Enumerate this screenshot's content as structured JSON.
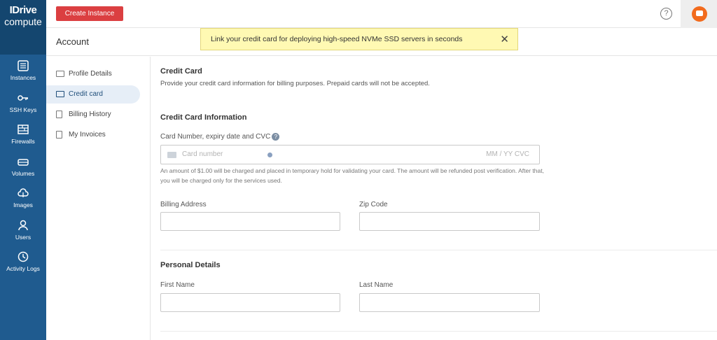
{
  "brand": {
    "line1": "IDrive",
    "line2": "compute"
  },
  "sidebar": {
    "items": [
      {
        "label": "Instances",
        "icon": "instances-icon"
      },
      {
        "label": "SSH Keys",
        "icon": "key-icon"
      },
      {
        "label": "Firewalls",
        "icon": "firewall-icon"
      },
      {
        "label": "Volumes",
        "icon": "volume-icon"
      },
      {
        "label": "Images",
        "icon": "cloud-upload-icon"
      },
      {
        "label": "Users",
        "icon": "user-icon"
      },
      {
        "label": "Activity Logs",
        "icon": "history-icon"
      }
    ]
  },
  "topbar": {
    "create_button": "Create Instance",
    "help": "?"
  },
  "account": {
    "title": "Account"
  },
  "banner": {
    "text": "Link your credit card for deploying high-speed NVMe SSD servers in seconds",
    "close": "✕"
  },
  "subnav": {
    "items": [
      {
        "label": "Profile Details"
      },
      {
        "label": "Credit card"
      },
      {
        "label": "Billing History"
      },
      {
        "label": "My Invoices"
      }
    ]
  },
  "credit_card": {
    "title": "Credit Card",
    "description": "Provide your credit card information for billing purposes. Prepaid cards will not be accepted.",
    "info_title": "Credit Card Information",
    "card_label": "Card Number, expiry date and CVC",
    "card_placeholder": "Card number",
    "expiry_placeholder": "MM / YY  CVC",
    "hint": "An amount of $1.00 will be charged and placed in temporary hold for validating your card. The amount will be refunded post verification. After that, you will be charged only for the services used.",
    "billing_address_label": "Billing Address",
    "zip_label": "Zip Code"
  },
  "personal": {
    "title": "Personal Details",
    "first_name_label": "First Name",
    "last_name_label": "Last Name"
  },
  "colors": {
    "sidebar": "#1f5b8f",
    "logo_bg": "#14466f",
    "create_button": "#db3f41",
    "banner": "#fff9b3",
    "avatar": "#f26b1d",
    "active_nav": "#e6eef7"
  }
}
